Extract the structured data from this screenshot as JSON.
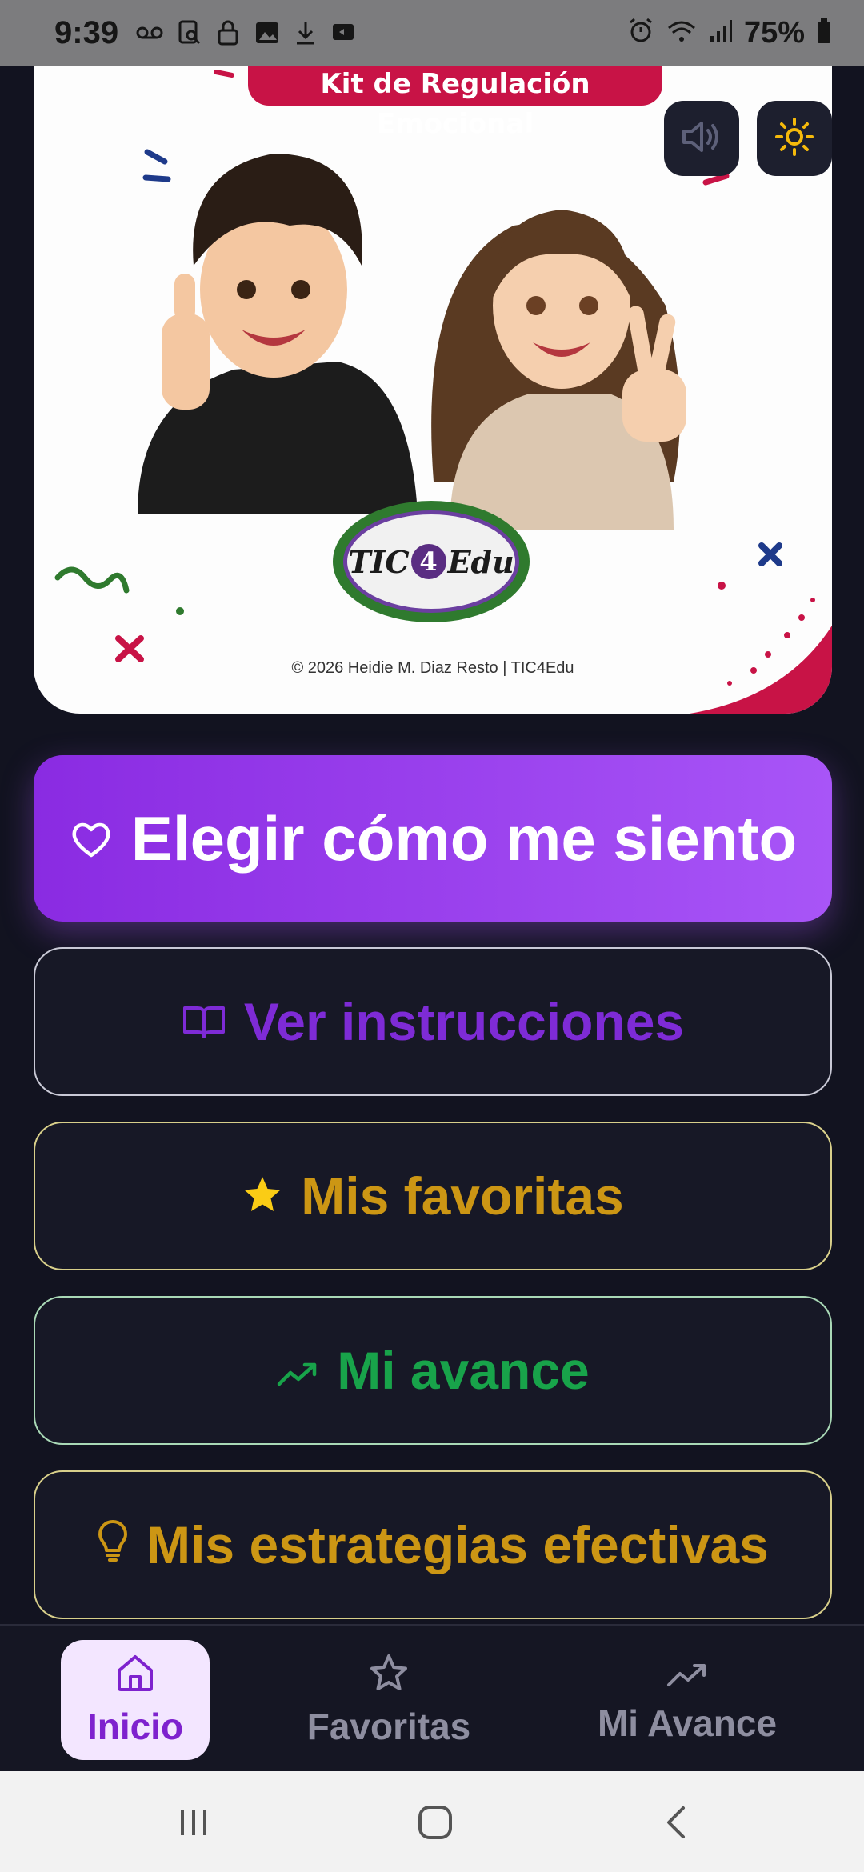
{
  "status_bar": {
    "time": "9:39",
    "battery": "75%"
  },
  "hero": {
    "banner": "Kit de Regulación Emocional",
    "logo_text_left": "TIC",
    "logo_text_num": "4",
    "logo_text_right": "Edu",
    "copyright": "© 2026 Heidie M. Diaz Resto | TIC4Edu",
    "sound_icon": "speaker-icon",
    "theme_icon": "sun-icon"
  },
  "buttons": {
    "feel": "Elegir cómo me siento",
    "instructions": "Ver instrucciones",
    "favorites": "Mis favoritas",
    "progress": "Mi avance",
    "strategies": "Mis estrategias efectivas"
  },
  "bottom_nav": {
    "home": "Inicio",
    "favorites": "Favoritas",
    "progress": "Mi Avance",
    "active": "home"
  },
  "colors": {
    "primary": "#8a2be2",
    "accent_purple": "#7e2bd6",
    "accent_gold": "#cc9614",
    "accent_green": "#18a34a",
    "background": "#121320",
    "banner_red": "#c81346"
  }
}
